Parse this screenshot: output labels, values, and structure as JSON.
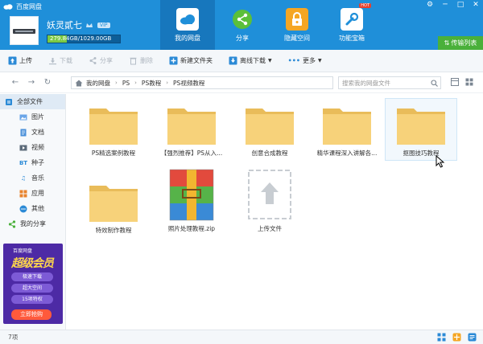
{
  "app": {
    "title": "百度网盘"
  },
  "user": {
    "name": "妖灵貳七",
    "vip_label": "VIP",
    "quota_text": "279.84GB/1029.00GB",
    "quota_fraction": 0.272
  },
  "nav": {
    "tabs": [
      {
        "label": "我的网盘",
        "icon": "cloud-icon"
      },
      {
        "label": "分享",
        "icon": "share-icon"
      },
      {
        "label": "隐藏空间",
        "icon": "lock-icon"
      },
      {
        "label": "功能宝箱",
        "icon": "toolbox-icon",
        "badge": "HOT"
      }
    ],
    "transfer_label": "传输列表"
  },
  "toolbar": {
    "upload": "上传",
    "download": "下载",
    "share": "分享",
    "delete": "删除",
    "new_folder": "新建文件夹",
    "offline_download": "离线下载",
    "more": "更多"
  },
  "address": {
    "crumbs": [
      "我的网盘",
      "PS",
      "PS教程",
      "PS视频教程"
    ],
    "search_placeholder": "搜索我的网盘文件"
  },
  "sidebar": {
    "all_files": "全部文件",
    "categories": [
      {
        "label": "图片",
        "icon": "image-icon"
      },
      {
        "label": "文档",
        "icon": "document-icon"
      },
      {
        "label": "视频",
        "icon": "video-icon"
      },
      {
        "label": "种子",
        "icon": "bt-icon"
      },
      {
        "label": "音乐",
        "icon": "music-icon"
      },
      {
        "label": "应用",
        "icon": "app-icon"
      },
      {
        "label": "其他",
        "icon": "other-icon"
      }
    ],
    "my_share": "我的分享"
  },
  "ad": {
    "brand": "百度网盘",
    "title": "超级会员",
    "lines": [
      "极速下载",
      "超大空间",
      "15项特权"
    ],
    "button": "立即抢购"
  },
  "files": [
    {
      "name": "PS精选案例教程",
      "type": "folder"
    },
    {
      "name": "【强烈推荐】PS从入...",
      "type": "folder"
    },
    {
      "name": "创意合成教程",
      "type": "folder"
    },
    {
      "name": "精华课程深入讲解各...",
      "type": "folder"
    },
    {
      "name": "抠图技巧教程",
      "type": "folder",
      "selected": true
    },
    {
      "name": "特效制作教程",
      "type": "folder"
    },
    {
      "name": "照片处理教程.zip",
      "type": "zip"
    },
    {
      "name": "上传文件",
      "type": "upload"
    }
  ],
  "status": {
    "count": "7项"
  },
  "colors": {
    "header": "#1f8fd9",
    "folder": "#f7d27a",
    "accent_green": "#4ab03a"
  }
}
